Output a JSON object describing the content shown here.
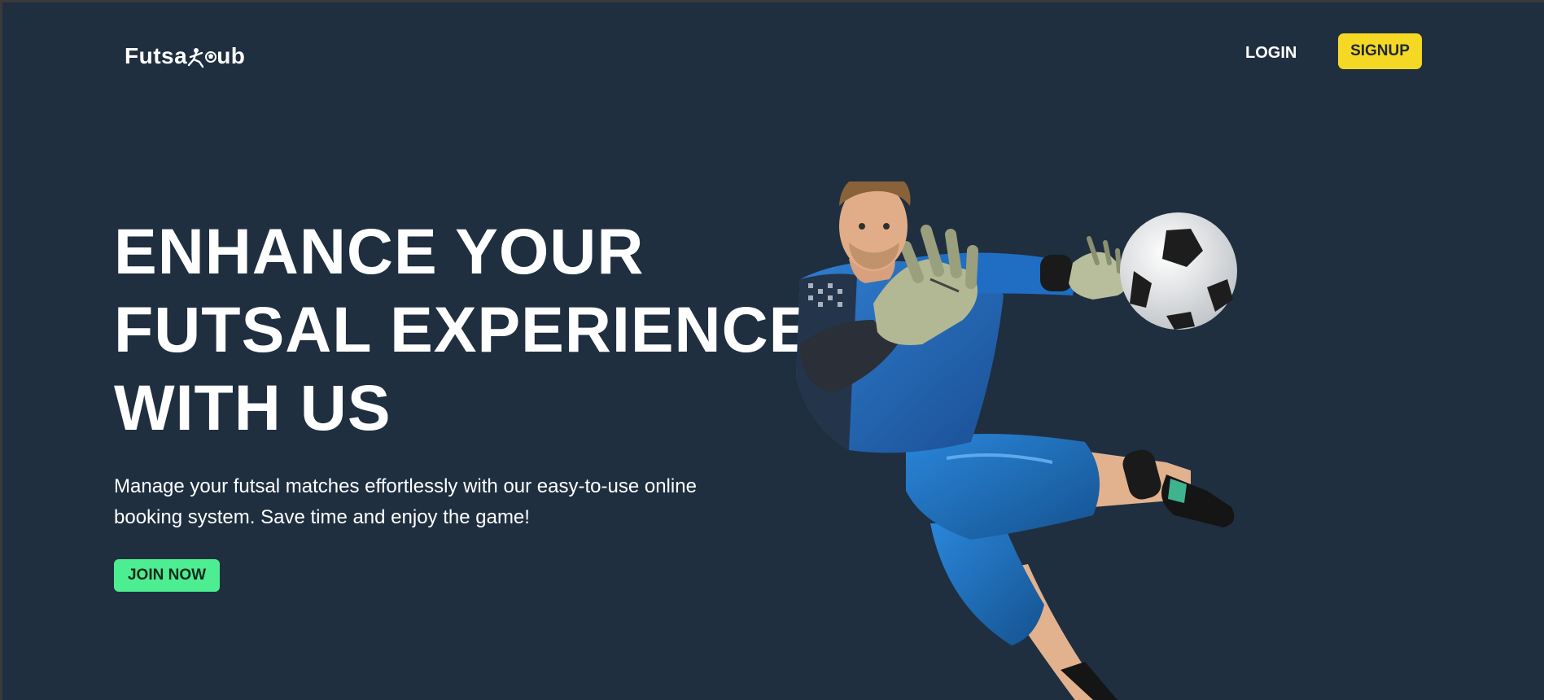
{
  "header": {
    "logo_text_left": "Futsa",
    "logo_text_right": "ub",
    "login_label": "LOGIN",
    "signup_label": "SIGNUP"
  },
  "hero": {
    "title_lines": [
      "ENHANCE YOUR",
      "FUTSAL EXPERIENCE",
      "WITH US"
    ],
    "subtitle_lines": [
      "Manage your futsal matches effortlessly with our easy-to-use online",
      "booking system. Save time and enjoy the game!"
    ],
    "cta_label": "JOIN NOW",
    "illustration": "goalkeeper-diving-with-ball"
  },
  "colors": {
    "background": "#1f2f40",
    "signup_accent": "#f5d823",
    "cta_accent": "#4ded91",
    "text": "#ffffff"
  }
}
